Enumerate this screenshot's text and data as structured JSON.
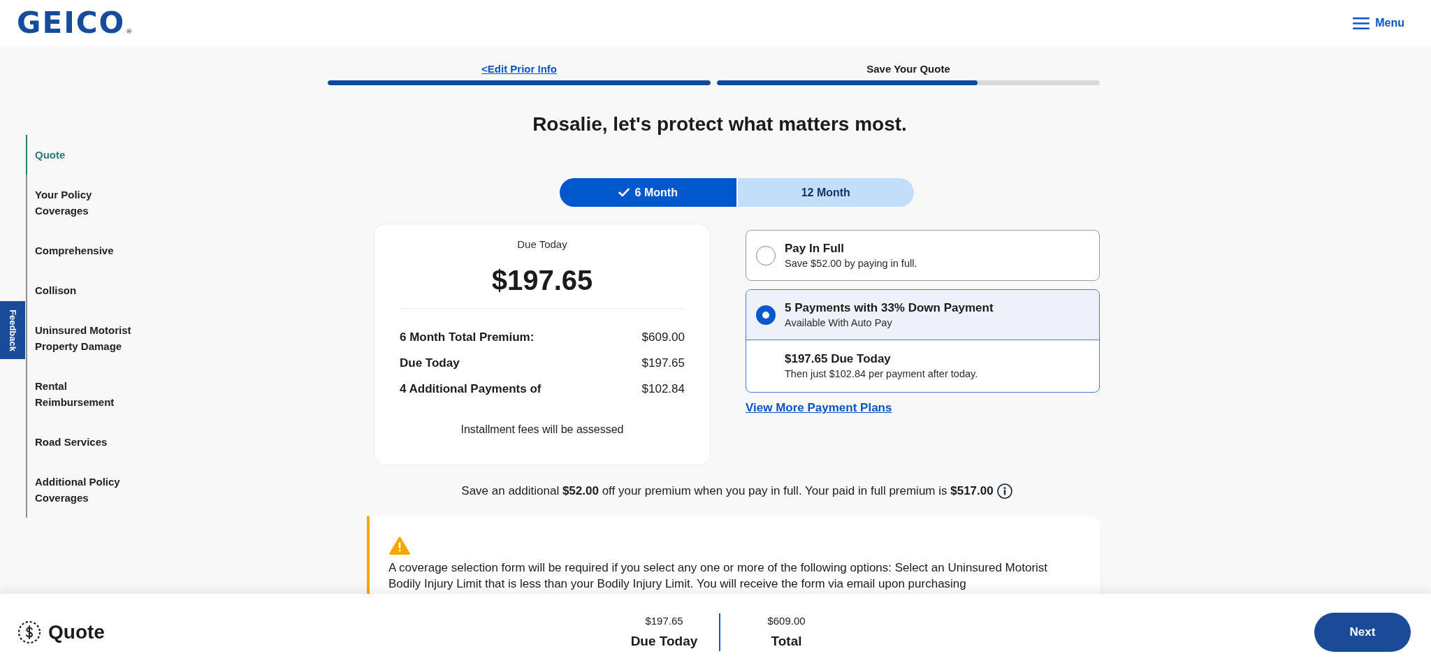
{
  "header": {
    "logo": "GEICO",
    "logo_mark": "®",
    "menu": "Menu"
  },
  "progress": {
    "steps": [
      {
        "label": "<Edit Prior Info",
        "kind": "link",
        "level": 1
      },
      {
        "label": "Save Your Quote",
        "kind": "current",
        "level": 0.68
      }
    ]
  },
  "sidebar": {
    "items": [
      {
        "label": "Quote",
        "selected": true
      },
      {
        "label": "Your Policy Coverages",
        "selected": false
      },
      {
        "label": "Comprehensive",
        "selected": false
      },
      {
        "label": "Collison",
        "selected": false
      },
      {
        "label": "Uninsured Motorist Property Damage",
        "selected": false
      },
      {
        "label": "Rental Reimbursement",
        "selected": false
      },
      {
        "label": "Road Services",
        "selected": false
      },
      {
        "label": "Additional Policy Coverages",
        "selected": false
      }
    ]
  },
  "feedback_tab": "Feedback",
  "heading": "Rosalie, let's protect what matters most.",
  "term_tabs": [
    {
      "label": "6 Month",
      "selected": true
    },
    {
      "label": "12 Month",
      "selected": false
    }
  ],
  "summary": {
    "caption": "Due Today",
    "amount": "$197.65",
    "rows": [
      {
        "label": "6 Month Total Premium:",
        "value": "$609.00"
      },
      {
        "label": "Due Today",
        "value": "$197.65"
      },
      {
        "label": "4 Additional Payments of",
        "value": "$102.84"
      }
    ],
    "note": "Installment fees will be assessed"
  },
  "payment_options": [
    {
      "title": "Pay In Full",
      "subtitle": "Save $52.00 by paying in full.",
      "selected": false
    },
    {
      "title": "5 Payments with 33% Down Payment",
      "subtitle": "Available With Auto Pay",
      "selected": true,
      "detail": {
        "title": "$197.65 Due Today",
        "subtitle": "Then just $102.84 per payment after today."
      }
    }
  ],
  "more_plans_link": "View More Payment Plans",
  "savings_note": "Save an additional **$52.00** off your premium when you pay in full. Your paid in full premium is **$517.00**",
  "warning": {
    "text": "A coverage selection form will be required if you select any one or more of the following options: Select an Uninsured Motorist Bodily Injury Limit that is less than your Bodily Injury Limit. You will receive the form via email upon purchasing"
  },
  "footer": {
    "title": "Quote",
    "amounts": [
      {
        "value": "$197.65",
        "label": "Due Today"
      },
      {
        "value": "$609.00",
        "label": "Total"
      }
    ],
    "next_button": "Next"
  }
}
